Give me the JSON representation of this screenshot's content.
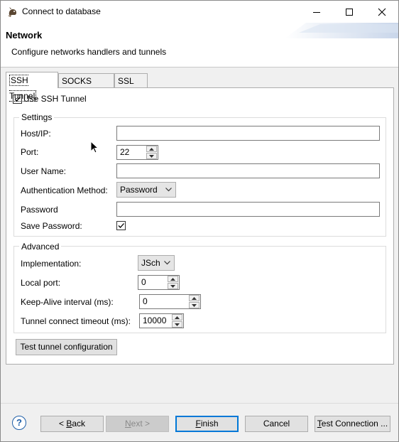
{
  "window": {
    "title": "Connect to database",
    "app_icon": "dbeaver-beaver-icon",
    "controls": [
      "minimize-icon",
      "maximize-icon",
      "close-icon"
    ]
  },
  "header": {
    "title": "Network",
    "description": "Configure networks handlers and tunnels"
  },
  "tabs": [
    {
      "label": "SSH Tunnel",
      "active": true
    },
    {
      "label": "SOCKS Proxy",
      "active": false
    },
    {
      "label": "SSL",
      "active": false
    }
  ],
  "ssh": {
    "use_ssh_tunnel": {
      "label": "Use SSH Tunnel",
      "checked": true
    },
    "settings": {
      "legend": "Settings",
      "host_label": "Host/IP:",
      "host_value": "",
      "port_label": "Port:",
      "port_value": "22",
      "user_label": "User Name:",
      "user_value": "",
      "auth_label": "Authentication Method:",
      "auth_value": "Password",
      "password_label": "Password",
      "password_value": "",
      "save_password_label": "Save Password:",
      "save_password_checked": true
    },
    "advanced": {
      "legend": "Advanced",
      "impl_label": "Implementation:",
      "impl_value": "JSch",
      "local_port_label": "Local port:",
      "local_port_value": "0",
      "keepalive_label": "Keep-Alive interval (ms):",
      "keepalive_value": "0",
      "timeout_label": "Tunnel connect timeout (ms):",
      "timeout_value": "10000"
    },
    "test_button": "Test tunnel configuration"
  },
  "footer": {
    "help": "?",
    "back": {
      "prefix": "< ",
      "mnemonic": "B",
      "rest": "ack"
    },
    "next": {
      "mnemonic": "N",
      "rest": "ext >"
    },
    "finish": {
      "mnemonic": "F",
      "rest": "inish"
    },
    "cancel": "Cancel",
    "test_connection": {
      "mnemonic": "T",
      "rest": "est Connection ..."
    }
  },
  "colors": {
    "accent": "#0078d7",
    "window_bg": "#f0f0f0",
    "panel_bg": "#ffffff",
    "border": "#adadad"
  }
}
